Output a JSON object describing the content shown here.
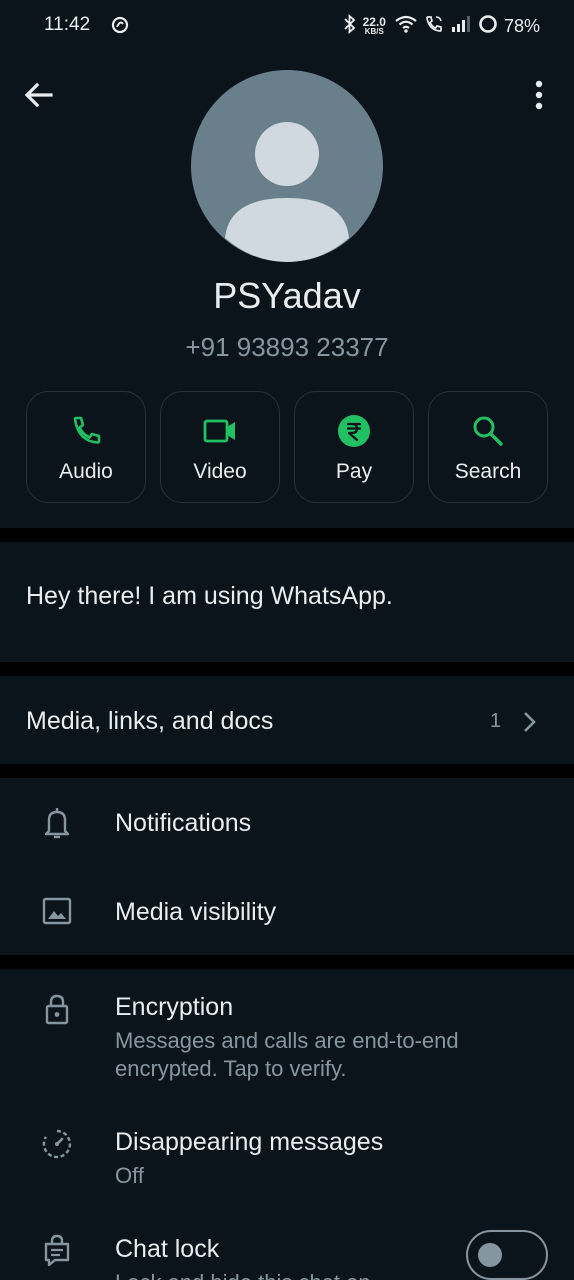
{
  "status_bar": {
    "time": "11:42",
    "net_speed_value": "22.0",
    "net_speed_unit": "KB/S",
    "battery": "78%",
    "icons": [
      "sync-icon",
      "bluetooth-icon",
      "wifi-icon",
      "wifi-calling-icon",
      "signal-icon",
      "battery-ring-icon"
    ]
  },
  "contact": {
    "name": "PSYadav",
    "phone": "+91 93893 23377"
  },
  "actions": [
    {
      "label": "Audio",
      "icon": "phone-icon"
    },
    {
      "label": "Video",
      "icon": "video-icon"
    },
    {
      "label": "Pay",
      "icon": "rupee-icon"
    },
    {
      "label": "Search",
      "icon": "search-icon"
    }
  ],
  "about": "Hey there! I am using WhatsApp.",
  "media": {
    "label": "Media, links, and docs",
    "count": "1"
  },
  "settings": {
    "notifications": "Notifications",
    "media_visibility": "Media visibility",
    "encryption_title": "Encryption",
    "encryption_sub": "Messages and calls are end-to-end encrypted. Tap to verify.",
    "disappearing_title": "Disappearing messages",
    "disappearing_sub": "Off",
    "chat_lock_title": "Chat lock",
    "chat_lock_sub": "Lock and hide this chat on",
    "chat_lock_enabled": false
  },
  "colors": {
    "background": "#0b141a",
    "accent_green": "#21c063",
    "text_primary": "#e9edef",
    "text_secondary": "#8696a0"
  }
}
